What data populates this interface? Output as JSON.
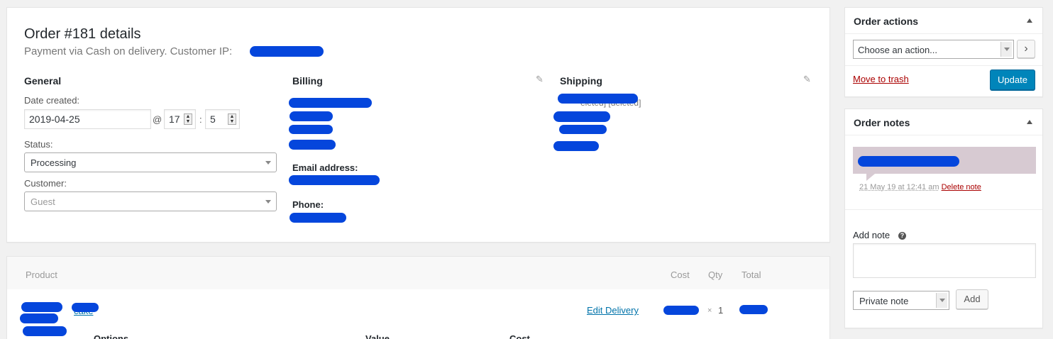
{
  "order": {
    "title": "Order #181 details",
    "subtitle": "Payment via Cash on delivery. Customer IP:",
    "general_heading": "General",
    "date_created_label": "Date created:",
    "date_value": "2019-04-25",
    "at_sign": "@",
    "hour_value": "17",
    "colon": ":",
    "minute_value": "5",
    "status_label": "Status:",
    "status_value": "Processing",
    "customer_label": "Customer:",
    "customer_value": "Guest",
    "billing_heading": "Billing",
    "email_label": "Email address:",
    "phone_label": "Phone:",
    "shipping_heading": "Shipping",
    "shipping_partial_text": "eleted] [deleted]",
    "edit_icon": "pencil-icon"
  },
  "items": {
    "col_product": "Product",
    "col_cost": "Cost",
    "col_qty": "Qty",
    "col_total": "Total",
    "row_link_partial": "cake",
    "edit_delivery": "Edit Delivery",
    "qty_sep": "×",
    "qty_value": "1",
    "sub_options": "Options",
    "sub_value": "Value",
    "sub_cost": "Cost"
  },
  "actions": {
    "title": "Order actions",
    "select_value": "Choose an action...",
    "go_glyph": "›",
    "trash_label": "Move to trash",
    "update_label": "Update"
  },
  "notes": {
    "title": "Order notes",
    "note_date": "21 May 19 at 12:41 am",
    "delete_label": "Delete note",
    "add_note_label": "Add note",
    "help_glyph": "?",
    "note_type_value": "Private note",
    "add_button": "Add"
  },
  "colors": {
    "primary_button": "#0085ba",
    "link": "#0073aa",
    "danger": "#aa0000",
    "redaction": "#0546dc",
    "note_bubble": "#d7cad2"
  }
}
